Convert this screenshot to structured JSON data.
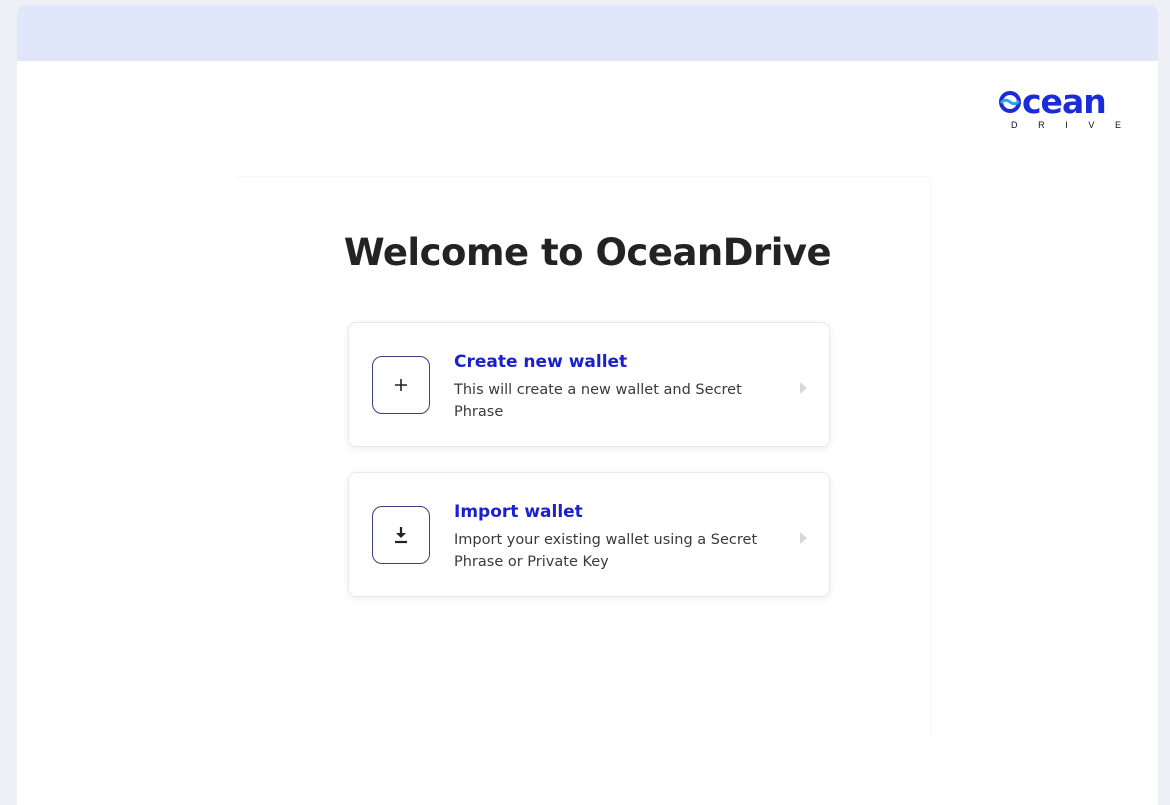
{
  "logo": {
    "word": "cean",
    "subtitle_letters": [
      "D",
      "R",
      "I",
      "V",
      "E"
    ],
    "color": "#1a2bd8"
  },
  "welcome": {
    "title": "Welcome to OceanDrive"
  },
  "options": [
    {
      "title": "Create new wallet",
      "description": "This will create a new wallet and Secret Phrase",
      "icon": "plus-icon"
    },
    {
      "title": "Import wallet",
      "description": "Import your existing wallet using a Secret Phrase or Private Key",
      "icon": "download-icon"
    }
  ],
  "colors": {
    "topbar": "#e1e7fa",
    "accent": "#1a1fd0",
    "icon_border": "#3c3f84",
    "page_bg": "#eef0f6"
  }
}
